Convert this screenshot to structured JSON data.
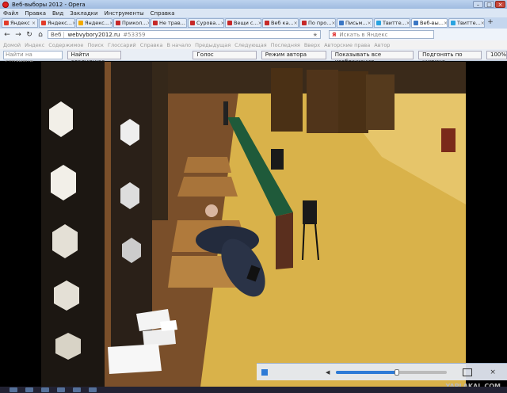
{
  "window": {
    "title": "Веб-выборы 2012 - Opera",
    "controls": [
      "–",
      "□",
      "×"
    ]
  },
  "menu": [
    "Файл",
    "Правка",
    "Вид",
    "Закладки",
    "Инструменты",
    "Справка"
  ],
  "tabs": [
    {
      "label": "Яндекс",
      "color": "#e23b2a",
      "active": false
    },
    {
      "label": "Яндекс...",
      "color": "#e23b2a",
      "active": false
    },
    {
      "label": "Яндекс...",
      "color": "#f2a900",
      "active": false
    },
    {
      "label": "Прикол...",
      "color": "#c62828",
      "active": false
    },
    {
      "label": "Не трав...",
      "color": "#c62828",
      "active": false
    },
    {
      "label": "Сурова...",
      "color": "#c62828",
      "active": false
    },
    {
      "label": "Вещи с...",
      "color": "#c62828",
      "active": false
    },
    {
      "label": "Веб ка...",
      "color": "#c62828",
      "active": false
    },
    {
      "label": "По про...",
      "color": "#c62828",
      "active": false
    },
    {
      "label": "Письм...",
      "color": "#3a76c4",
      "active": false
    },
    {
      "label": "Твитте...",
      "color": "#29a3e0",
      "active": false
    },
    {
      "label": "Веб-вы...",
      "color": "#3a76c4",
      "active": true
    },
    {
      "label": "Твитте...",
      "color": "#29a3e0",
      "active": false
    }
  ],
  "nav": {
    "back": "←",
    "forward": "→",
    "reload": "↻",
    "home": "⌂",
    "web_label": "Веб",
    "url": "webvybory2012.ru",
    "url_hash": "#53359",
    "star": "★",
    "search_brand": "Я",
    "search_placeholder": "Искать в Яндекс"
  },
  "links": [
    "Домой",
    "Индекс",
    "Содержимое",
    "Поиск",
    "Глоссарий",
    "Справка",
    "В начало",
    "Предыдущая",
    "Следующая",
    "Последняя",
    "Вверх",
    "Авторские права",
    "Автор"
  ],
  "findbar": {
    "find_placeholder": "Найти на странице",
    "find_next": "Найти следующее",
    "voice": "Голос",
    "author_mode": "Режим автора",
    "show_images": "Показывать все изображения",
    "fit_width": "Подгонять по ширине",
    "zoom": "100%"
  },
  "player": {
    "volume_icon": "◀",
    "progress": 0.55,
    "close": "×"
  },
  "watermark": "YAPLAKAL.COM"
}
